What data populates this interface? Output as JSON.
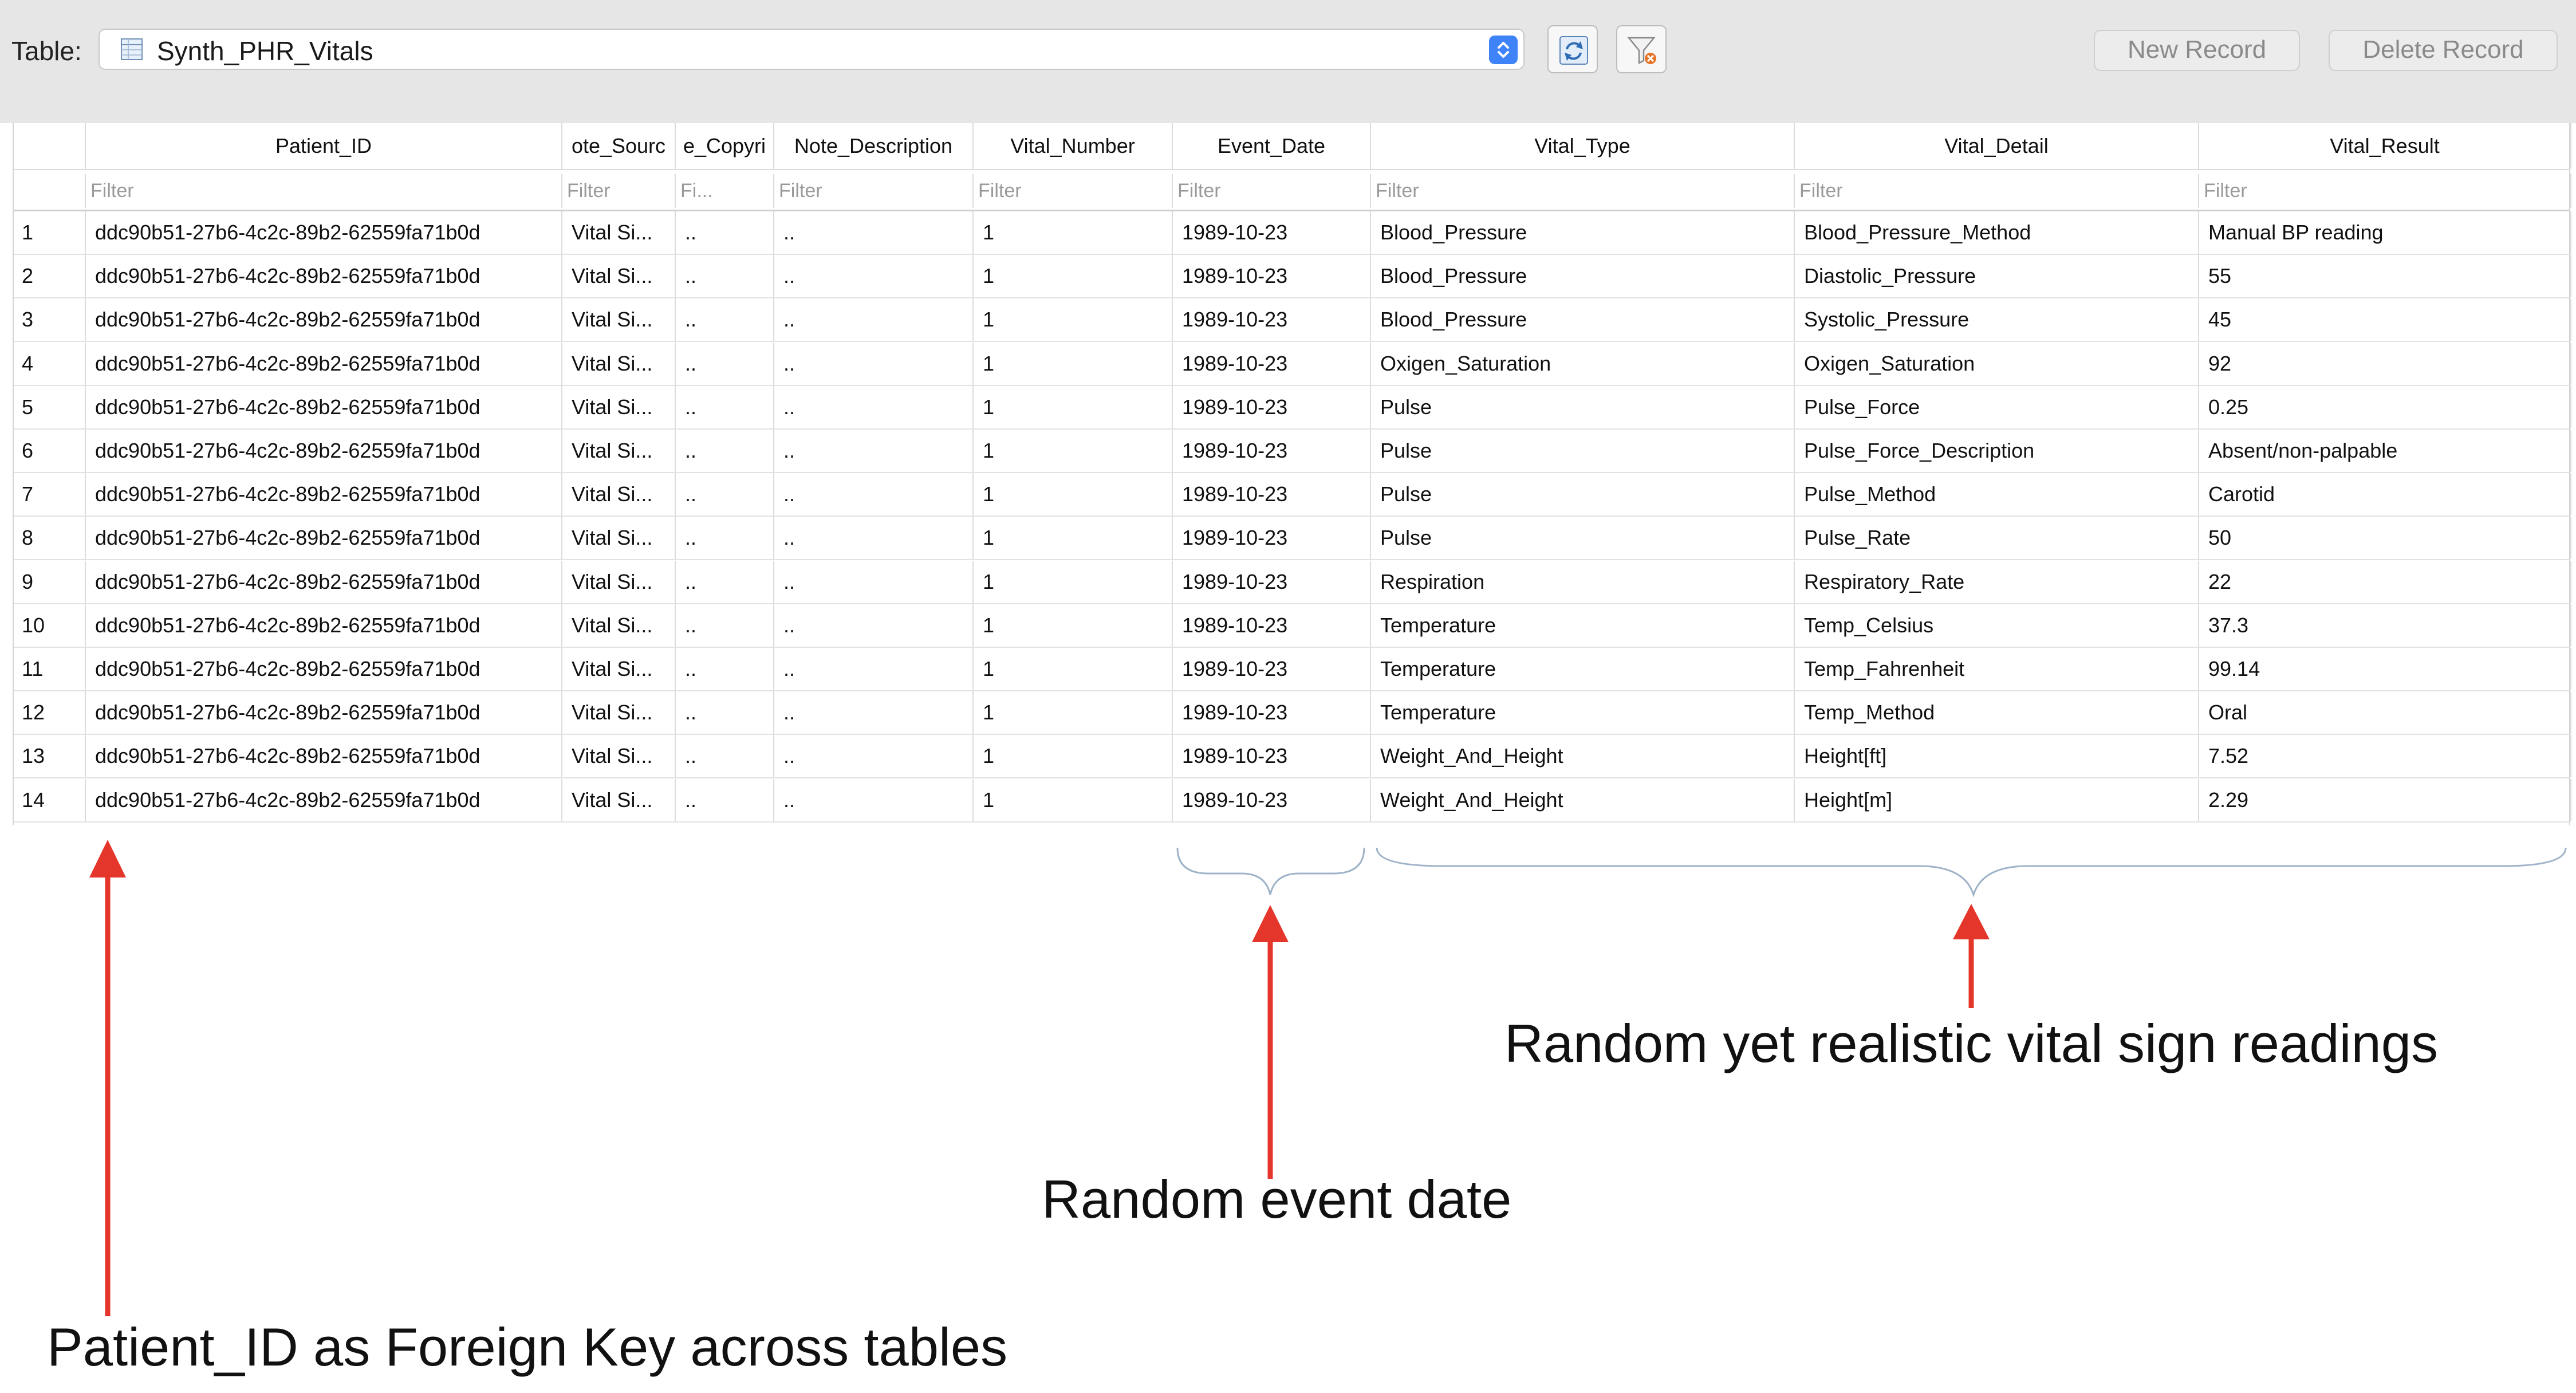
{
  "toolbar": {
    "table_label": "Table:",
    "table_name": "Synth_PHR_Vitals",
    "new_record": "New Record",
    "delete_record": "Delete Record"
  },
  "columns": [
    {
      "header": "",
      "filter": ""
    },
    {
      "header": "Patient_ID",
      "filter": "Filter"
    },
    {
      "header": "ote_Sourc",
      "filter": "Filter"
    },
    {
      "header": "e_Copyri",
      "filter": "Fi..."
    },
    {
      "header": "Note_Description",
      "filter": "Filter"
    },
    {
      "header": "Vital_Number",
      "filter": "Filter"
    },
    {
      "header": "Event_Date",
      "filter": "Filter"
    },
    {
      "header": "Vital_Type",
      "filter": "Filter"
    },
    {
      "header": "Vital_Detail",
      "filter": "Filter"
    },
    {
      "header": "Vital_Result",
      "filter": "Filter"
    }
  ],
  "rows": [
    [
      "1",
      "ddc90b51-27b6-4c2c-89b2-62559fa71b0d",
      "Vital Si...",
      "..",
      "..",
      "1",
      "1989-10-23",
      "Blood_Pressure",
      "Blood_Pressure_Method",
      "Manual BP reading"
    ],
    [
      "2",
      "ddc90b51-27b6-4c2c-89b2-62559fa71b0d",
      "Vital Si...",
      "..",
      "..",
      "1",
      "1989-10-23",
      "Blood_Pressure",
      "Diastolic_Pressure",
      "55"
    ],
    [
      "3",
      "ddc90b51-27b6-4c2c-89b2-62559fa71b0d",
      "Vital Si...",
      "..",
      "..",
      "1",
      "1989-10-23",
      "Blood_Pressure",
      "Systolic_Pressure",
      "45"
    ],
    [
      "4",
      "ddc90b51-27b6-4c2c-89b2-62559fa71b0d",
      "Vital Si...",
      "..",
      "..",
      "1",
      "1989-10-23",
      "Oxigen_Saturation",
      "Oxigen_Saturation",
      "92"
    ],
    [
      "5",
      "ddc90b51-27b6-4c2c-89b2-62559fa71b0d",
      "Vital Si...",
      "..",
      "..",
      "1",
      "1989-10-23",
      "Pulse",
      "Pulse_Force",
      "0.25"
    ],
    [
      "6",
      "ddc90b51-27b6-4c2c-89b2-62559fa71b0d",
      "Vital Si...",
      "..",
      "..",
      "1",
      "1989-10-23",
      "Pulse",
      "Pulse_Force_Description",
      "Absent/non-palpable"
    ],
    [
      "7",
      "ddc90b51-27b6-4c2c-89b2-62559fa71b0d",
      "Vital Si...",
      "..",
      "..",
      "1",
      "1989-10-23",
      "Pulse",
      "Pulse_Method",
      "Carotid"
    ],
    [
      "8",
      "ddc90b51-27b6-4c2c-89b2-62559fa71b0d",
      "Vital Si...",
      "..",
      "..",
      "1",
      "1989-10-23",
      "Pulse",
      "Pulse_Rate",
      "50"
    ],
    [
      "9",
      "ddc90b51-27b6-4c2c-89b2-62559fa71b0d",
      "Vital Si...",
      "..",
      "..",
      "1",
      "1989-10-23",
      "Respiration",
      "Respiratory_Rate",
      "22"
    ],
    [
      "10",
      "ddc90b51-27b6-4c2c-89b2-62559fa71b0d",
      "Vital Si...",
      "..",
      "..",
      "1",
      "1989-10-23",
      "Temperature",
      "Temp_Celsius",
      "37.3"
    ],
    [
      "11",
      "ddc90b51-27b6-4c2c-89b2-62559fa71b0d",
      "Vital Si...",
      "..",
      "..",
      "1",
      "1989-10-23",
      "Temperature",
      "Temp_Fahrenheit",
      "99.14"
    ],
    [
      "12",
      "ddc90b51-27b6-4c2c-89b2-62559fa71b0d",
      "Vital Si...",
      "..",
      "..",
      "1",
      "1989-10-23",
      "Temperature",
      "Temp_Method",
      "Oral"
    ],
    [
      "13",
      "ddc90b51-27b6-4c2c-89b2-62559fa71b0d",
      "Vital Si...",
      "..",
      "..",
      "1",
      "1989-10-23",
      "Weight_And_Height",
      "Height[ft]",
      "7.52"
    ],
    [
      "14",
      "ddc90b51-27b6-4c2c-89b2-62559fa71b0d",
      "Vital Si...",
      "..",
      "..",
      "1",
      "1989-10-23",
      "Weight_And_Height",
      "Height[m]",
      "2.29"
    ]
  ],
  "annotations": {
    "vitals": "Random yet realistic vital sign readings",
    "event_date": "Random event date",
    "patient_id": "Patient_ID as Foreign Key across tables"
  },
  "colors": {
    "arrow": "#e5362b",
    "brace": "#9fb3c8",
    "stepper": "#3f83f8"
  }
}
